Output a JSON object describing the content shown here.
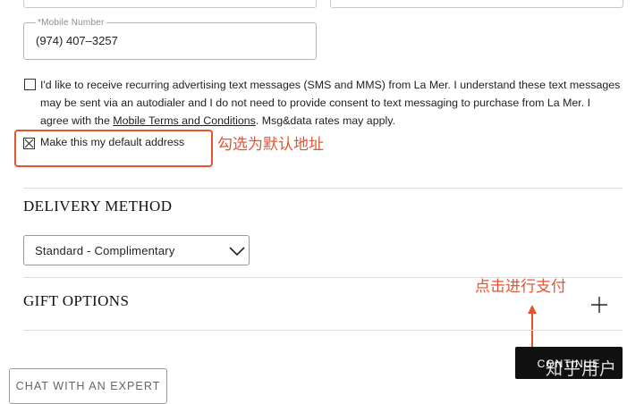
{
  "form": {
    "mobile_label": "*Mobile Number",
    "mobile_value": "(974) 407–3257",
    "sms_consent_text_before": "I'd like to receive recurring advertising text messages (SMS and MMS) from La Mer. I understand these text messages may be sent via an autodialer and I do not need to provide consent to text messaging to purchase from La Mer. I agree with the ",
    "sms_consent_link": "Mobile Terms and Conditions",
    "sms_consent_text_after": ". Msg&data rates may apply.",
    "sms_checked": false,
    "default_address_label": "Make this my default address",
    "default_address_checked": true
  },
  "annotations": {
    "default_note": "勾选为默认地址",
    "pay_note": "点击进行支付"
  },
  "delivery": {
    "title": "DELIVERY METHOD",
    "selected_option": "Standard - Complimentary"
  },
  "gift": {
    "title": "GIFT OPTIONS"
  },
  "actions": {
    "continue_label": "CONTINUE",
    "chat_label": "CHAT WITH AN EXPERT"
  },
  "watermark": "知乎用户",
  "colors": {
    "annotation": "#e8532f",
    "button": "#111111"
  }
}
